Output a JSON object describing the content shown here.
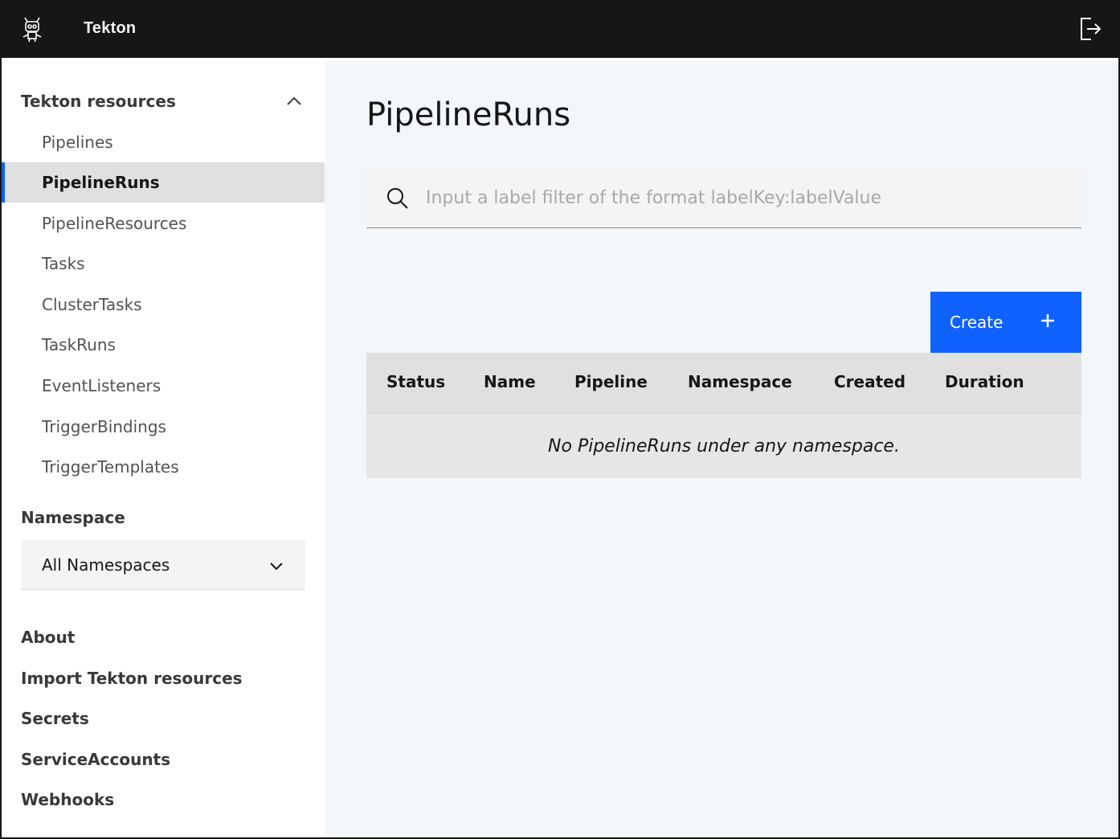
{
  "header": {
    "app_title": "Tekton",
    "logo_icon": "tekton-robot-icon",
    "logout_icon": "logout-icon"
  },
  "sidebar": {
    "section_title": "Tekton resources",
    "items": [
      {
        "label": "Pipelines",
        "active": false
      },
      {
        "label": "PipelineRuns",
        "active": true
      },
      {
        "label": "PipelineResources",
        "active": false
      },
      {
        "label": "Tasks",
        "active": false
      },
      {
        "label": "ClusterTasks",
        "active": false
      },
      {
        "label": "TaskRuns",
        "active": false
      },
      {
        "label": "EventListeners",
        "active": false
      },
      {
        "label": "TriggerBindings",
        "active": false
      },
      {
        "label": "TriggerTemplates",
        "active": false
      }
    ],
    "namespace_label": "Namespace",
    "namespace_value": "All Namespaces",
    "bottom_links": [
      "About",
      "Import Tekton resources",
      "Secrets",
      "ServiceAccounts",
      "Webhooks"
    ]
  },
  "main": {
    "title": "PipelineRuns",
    "search": {
      "placeholder": "Input a label filter of the format labelKey:labelValue",
      "value": ""
    },
    "create_label": "Create",
    "table": {
      "columns": [
        "Status",
        "Name",
        "Pipeline",
        "Namespace",
        "Created",
        "Duration"
      ],
      "empty_message": "No PipelineRuns under any namespace."
    }
  },
  "colors": {
    "header_bg": "#161616",
    "accent": "#0f62fe",
    "main_bg": "#f3f6fb",
    "active_item_bg": "#e0e0e0"
  }
}
